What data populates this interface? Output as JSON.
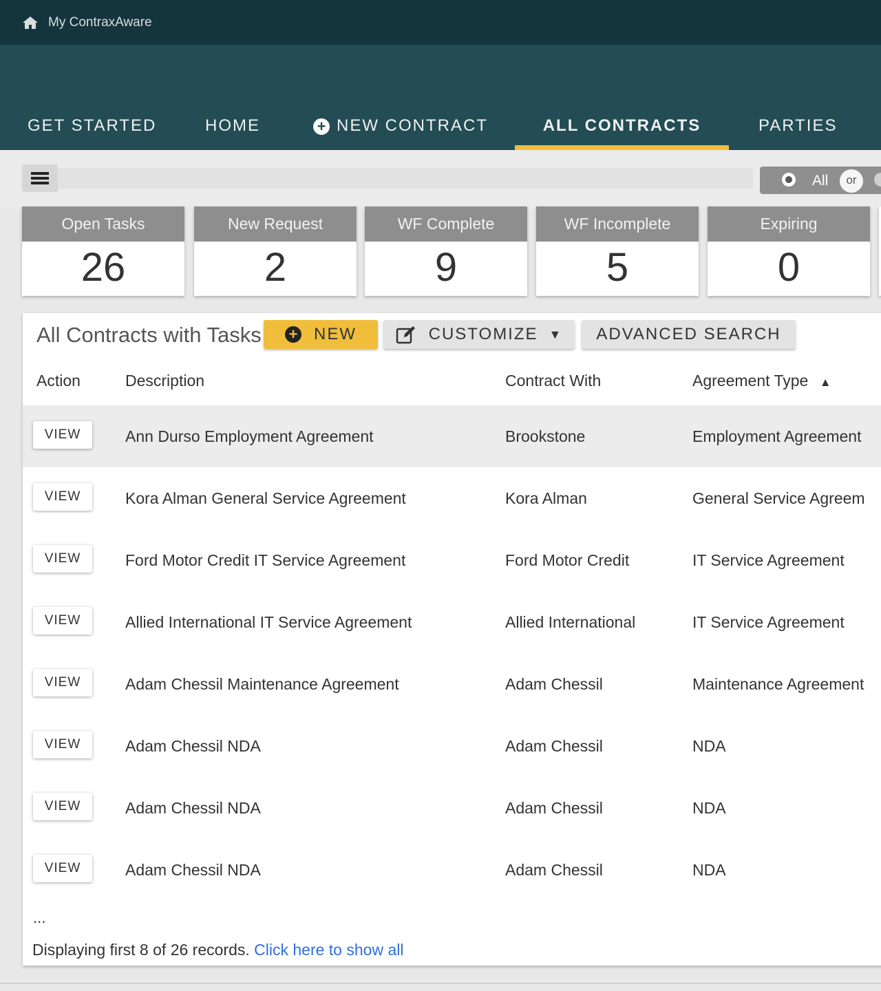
{
  "topbar": {
    "brand": "My ContraxAware"
  },
  "nav": {
    "items": [
      {
        "label": "GET STARTED"
      },
      {
        "label": "HOME"
      },
      {
        "label": "NEW CONTRACT"
      },
      {
        "label": "ALL CONTRACTS",
        "active": true
      },
      {
        "label": "PARTIES"
      }
    ]
  },
  "filter": {
    "all_label": "All",
    "or_label": "or"
  },
  "stats": [
    {
      "label": "Open Tasks",
      "value": "26"
    },
    {
      "label": "New Request",
      "value": "2"
    },
    {
      "label": "WF Complete",
      "value": "9"
    },
    {
      "label": "WF Incomplete",
      "value": "5"
    },
    {
      "label": "Expiring",
      "value": "0"
    }
  ],
  "panel": {
    "title": "All Contracts with Tasks",
    "new_label": "NEW",
    "customize_label": "CUSTOMIZE",
    "advanced_search_label": "ADVANCED SEARCH"
  },
  "table": {
    "columns": [
      "Action",
      "Description",
      "Contract With",
      "Agreement Type"
    ],
    "sort_indicator": "▲",
    "view_label": "VIEW",
    "rows": [
      {
        "description": "Ann Durso Employment Agreement",
        "contract_with": "Brookstone",
        "agreement_type": "Employment Agreement"
      },
      {
        "description": "Kora Alman General Service Agreement",
        "contract_with": "Kora Alman",
        "agreement_type": "General Service Agreem"
      },
      {
        "description": "Ford Motor Credit IT Service Agreement",
        "contract_with": "Ford Motor Credit",
        "agreement_type": "IT Service Agreement"
      },
      {
        "description": "Allied International IT Service Agreement",
        "contract_with": "Allied International",
        "agreement_type": "IT Service Agreement"
      },
      {
        "description": "Adam Chessil Maintenance Agreement",
        "contract_with": "Adam Chessil",
        "agreement_type": "Maintenance Agreement"
      },
      {
        "description": "Adam Chessil NDA",
        "contract_with": "Adam Chessil",
        "agreement_type": "NDA"
      },
      {
        "description": "Adam Chessil NDA",
        "contract_with": "Adam Chessil",
        "agreement_type": "NDA"
      },
      {
        "description": "Adam Chessil NDA",
        "contract_with": "Adam Chessil",
        "agreement_type": "NDA"
      }
    ],
    "ellipsis": "...",
    "footer_text": "Displaying first 8 of 26 records.",
    "footer_link": "Click here to show all"
  },
  "colors": {
    "topbar": "#15353d",
    "navband": "#234c54",
    "accent": "#f0be3a",
    "link": "#2f6fdc"
  }
}
